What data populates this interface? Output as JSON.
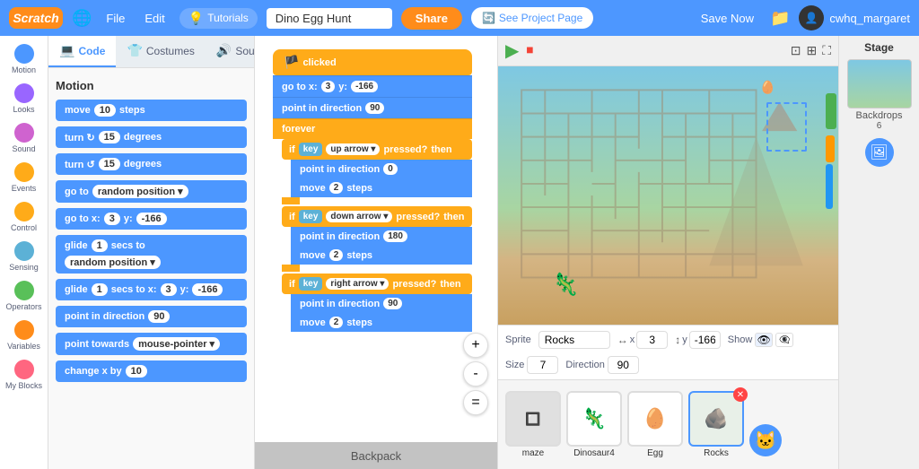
{
  "header": {
    "logo": "Scratch",
    "globe_label": "🌐",
    "file_label": "File",
    "edit_label": "Edit",
    "tutorials_label": "Tutorials",
    "project_name": "Dino Egg Hunt",
    "share_label": "Share",
    "see_project_label": "See Project Page",
    "save_label": "Save Now",
    "user_label": "cwhq_margaret"
  },
  "tabs": {
    "code_label": "Code",
    "costumes_label": "Costumes",
    "sounds_label": "Sounds"
  },
  "palette": {
    "items": [
      {
        "label": "Motion",
        "color": "#4c97ff"
      },
      {
        "label": "Looks",
        "color": "#9966ff"
      },
      {
        "label": "Sound",
        "color": "#cf63cf"
      },
      {
        "label": "Events",
        "color": "#ffab19"
      },
      {
        "label": "Control",
        "color": "#ffab19"
      },
      {
        "label": "Sensing",
        "color": "#5cb1d6"
      },
      {
        "label": "Operators",
        "color": "#59c059"
      },
      {
        "label": "Variables",
        "color": "#ff8c1a"
      },
      {
        "label": "My Blocks",
        "color": "#ff6680"
      }
    ]
  },
  "code_blocks": {
    "section": "Motion",
    "blocks": [
      {
        "text": "move 10 steps",
        "type": "blue"
      },
      {
        "text": "turn ↻ 15 degrees",
        "type": "blue"
      },
      {
        "text": "turn ↺ 15 degrees",
        "type": "blue"
      },
      {
        "text": "go to random position ▾",
        "type": "blue"
      },
      {
        "text": "go to x: 3 y: -166",
        "type": "blue"
      },
      {
        "text": "glide 1 secs to random position ▾",
        "type": "blue"
      },
      {
        "text": "glide 1 secs to x: 3 y: -166",
        "type": "blue"
      },
      {
        "text": "point in direction 90",
        "type": "blue"
      },
      {
        "text": "point towards mouse-pointer ▾",
        "type": "blue"
      },
      {
        "text": "change x by 10",
        "type": "blue"
      }
    ]
  },
  "script": {
    "hat": "when 🏴 clicked",
    "goto": "go to x: 3 y: -166",
    "direction": "point in direction 90",
    "forever": "forever",
    "if1_cond": "key up arrow ▾ pressed?",
    "if1_dir": "point in direction 0",
    "if1_move": "move 2 steps",
    "if2_cond": "key down arrow ▾ pressed?",
    "if2_dir": "point in direction 180",
    "if2_move": "move 2 steps",
    "if3_cond": "key right arrow ▾ pressed?",
    "if3_dir": "point in direction 90",
    "if3_move": "move 2 steps"
  },
  "sprite_info": {
    "label": "Sprite",
    "name": "Rocks",
    "x_label": "x",
    "x_val": "3",
    "y_label": "y",
    "y_val": "-166",
    "show_label": "Show",
    "size_label": "Size",
    "size_val": "7",
    "direction_label": "Direction",
    "direction_val": "90"
  },
  "sprites": [
    {
      "label": "maze",
      "active": false,
      "icon": "🔲"
    },
    {
      "label": "Dinosaur4",
      "active": false,
      "icon": "🦎"
    },
    {
      "label": "Egg",
      "active": false,
      "icon": "🥚"
    },
    {
      "label": "Rocks",
      "active": true,
      "icon": "🪨"
    }
  ],
  "stage": {
    "label": "Stage",
    "backdrops_label": "Backdrops",
    "backdrops_count": "6"
  },
  "zoom": {
    "in": "+",
    "out": "-",
    "fit": "="
  },
  "backpack": {
    "label": "Backpack"
  }
}
